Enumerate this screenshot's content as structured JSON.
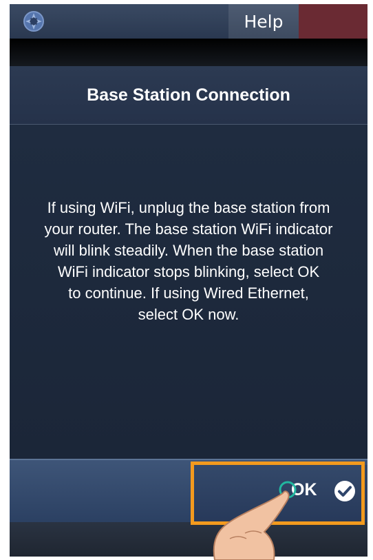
{
  "header": {
    "help_label": "Help"
  },
  "dialog": {
    "title": "Base Station Connection",
    "message_lines": [
      "If using WiFi, unplug the base station from",
      "your router. The base station WiFi indicator",
      "will blink steadily. When the base station",
      "WiFi indicator stops blinking, select OK",
      "to continue. If using Wired Ethernet,",
      "select OK now."
    ]
  },
  "footer": {
    "ok_label": "OK"
  },
  "colors": {
    "highlight": "#f39a1e",
    "background": "#1d2a3d",
    "accent_red": "#6a2a33"
  },
  "icons": {
    "app": "app-logo-icon",
    "confirm": "checkmark-circle-icon",
    "pointer": "hand-pointer-icon"
  }
}
